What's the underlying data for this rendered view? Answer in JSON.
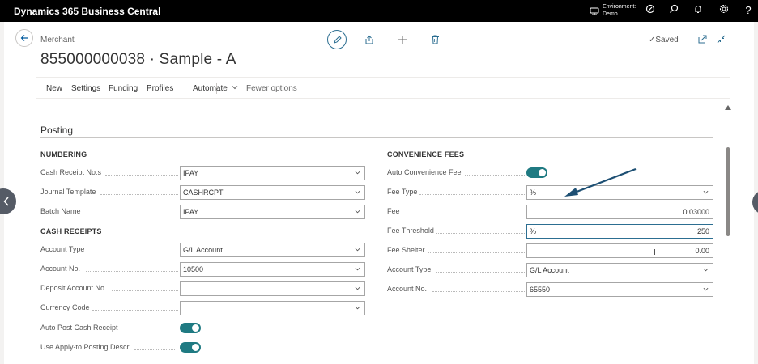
{
  "topbar": {
    "app_title": "Dynamics 365 Business Central",
    "environment_label": "Environment:",
    "environment_value": "Demo"
  },
  "header": {
    "caption": "Merchant",
    "title": "855000000038 · Sample - A",
    "saved_label": "✓Saved"
  },
  "actionbar": {
    "items": [
      "New",
      "Settings",
      "Funding",
      "Profiles"
    ],
    "automate": "Automate",
    "fewer": "Fewer options"
  },
  "section": {
    "title": "Posting"
  },
  "numbering": {
    "header": "NUMBERING",
    "fields": [
      {
        "label": "Cash Receipt No.s",
        "value": "IPAY"
      },
      {
        "label": "Journal Template",
        "value": "CASHRCPT"
      },
      {
        "label": "Batch Name",
        "value": "IPAY"
      }
    ]
  },
  "cash_receipts": {
    "header": "CASH RECEIPTS",
    "fields": [
      {
        "label": "Account Type",
        "value": "G/L Account"
      },
      {
        "label": "Account No.",
        "value": "10500"
      },
      {
        "label": "Deposit Account No.",
        "value": ""
      },
      {
        "label": "Currency Code",
        "value": ""
      }
    ],
    "toggles": [
      {
        "label": "Auto Post Cash Receipt",
        "on": true
      },
      {
        "label": "Use Apply-to Posting Descr.",
        "on": true
      }
    ]
  },
  "convenience_fees": {
    "header": "CONVENIENCE FEES",
    "auto_fee_label": "Auto Convenience Fee",
    "auto_fee_on": true,
    "fields": [
      {
        "label": "Fee Type",
        "value": "%"
      },
      {
        "label": "Fee",
        "value": "0.03000"
      },
      {
        "label": "Fee Threshold",
        "prefix": "%",
        "value": "250"
      },
      {
        "label": "Fee Shelter",
        "value": "0.00"
      },
      {
        "label": "Account Type",
        "value": "G/L Account"
      },
      {
        "label": "Account No.",
        "value": "65550"
      }
    ]
  },
  "colors": {
    "accent": "#2c6e91",
    "toggle_on": "#1f7a82",
    "topbar": "#000000"
  }
}
